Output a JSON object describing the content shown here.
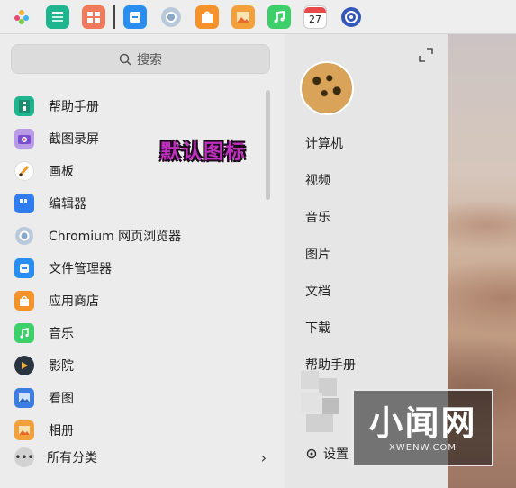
{
  "dock": {
    "icons": [
      {
        "name": "launcher-icon",
        "color": "#6ab0e8"
      },
      {
        "name": "deepin-manual-icon",
        "color": "#1fb58e"
      },
      {
        "name": "multitask-view-icon",
        "color": "#f07a5a"
      },
      {
        "name": "file-manager-icon",
        "color": "#2a8ef0"
      },
      {
        "name": "chromium-icon",
        "color": "#9bb6d6"
      },
      {
        "name": "app-store-icon",
        "color": "#f5922a"
      },
      {
        "name": "image-viewer-icon",
        "color": "#f3a03a"
      },
      {
        "name": "music-icon",
        "color": "#3ccf6a"
      },
      {
        "name": "calendar-icon",
        "color": "#ffffff"
      },
      {
        "name": "control-center-icon",
        "color": "#3558b8"
      }
    ],
    "calendar_day": "27"
  },
  "search": {
    "placeholder": "搜索",
    "icon": "search-icon"
  },
  "apps": [
    {
      "label": "帮助手册",
      "icon": "deepin-manual-icon",
      "color": "#1fb58e"
    },
    {
      "label": "截图录屏",
      "icon": "screenshot-icon",
      "color": "#7a4fd0"
    },
    {
      "label": "画板",
      "icon": "draw-icon",
      "color": "#ffffff"
    },
    {
      "label": "编辑器",
      "icon": "text-editor-icon",
      "color": "#2f7df0"
    },
    {
      "label": "Chromium 网页浏览器",
      "icon": "chromium-icon",
      "color": "#9bb6d6"
    },
    {
      "label": "文件管理器",
      "icon": "file-manager-icon",
      "color": "#2a8ef0"
    },
    {
      "label": "应用商店",
      "icon": "app-store-icon",
      "color": "#f5922a"
    },
    {
      "label": "音乐",
      "icon": "music-icon",
      "color": "#3ccf6a"
    },
    {
      "label": "影院",
      "icon": "movie-icon",
      "color": "#2a3340"
    },
    {
      "label": "看图",
      "icon": "image-viewer-icon",
      "color": "#3b7de0"
    },
    {
      "label": "相册",
      "icon": "album-icon",
      "color": "#f3a03a"
    }
  ],
  "category": {
    "label": "所有分类"
  },
  "places": [
    "计算机",
    "视频",
    "音乐",
    "图片",
    "文档",
    "下载",
    "帮助手册"
  ],
  "settings": {
    "label": "设置"
  },
  "overlay_label": "默认图标",
  "watermark": {
    "main": "小闻网",
    "sub": "XWENW.COM"
  }
}
